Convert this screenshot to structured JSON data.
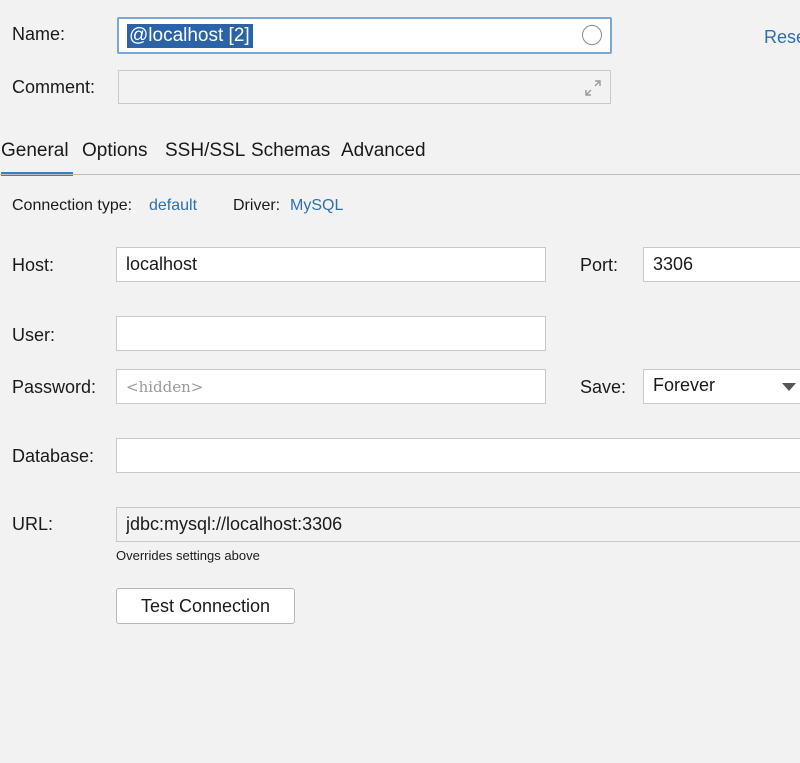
{
  "name": {
    "label": "Name:",
    "value": "@localhost [2]"
  },
  "reset_link": "Rese",
  "comment": {
    "label": "Comment:",
    "value": ""
  },
  "tabs": [
    {
      "label": "General",
      "active": true
    },
    {
      "label": "Options"
    },
    {
      "label": "SSH/SSL"
    },
    {
      "label": "Schemas"
    },
    {
      "label": "Advanced"
    }
  ],
  "connection": {
    "type_label": "Connection type:",
    "type_value": "default",
    "driver_label": "Driver:",
    "driver_value": "MySQL"
  },
  "host": {
    "label": "Host:",
    "value": "localhost"
  },
  "port": {
    "label": "Port:",
    "value": "3306"
  },
  "user": {
    "label": "User:",
    "value": ""
  },
  "password": {
    "label": "Password:",
    "placeholder": "<hidden>"
  },
  "save": {
    "label": "Save:",
    "value": "Forever"
  },
  "database": {
    "label": "Database:",
    "value": ""
  },
  "url": {
    "label": "URL:",
    "value": "jdbc:mysql://localhost:3306",
    "hint": "Overrides settings above"
  },
  "test_button": "Test Connection",
  "colors": {
    "accent": "#3a7fc4",
    "link": "#2f6fad",
    "selection": "#2b63a8",
    "background": "#f2f2f2"
  },
  "icons": {
    "name_status": "circle-icon",
    "comment_expand": "expand-icon",
    "save_dropdown": "chevron-down-icon"
  }
}
